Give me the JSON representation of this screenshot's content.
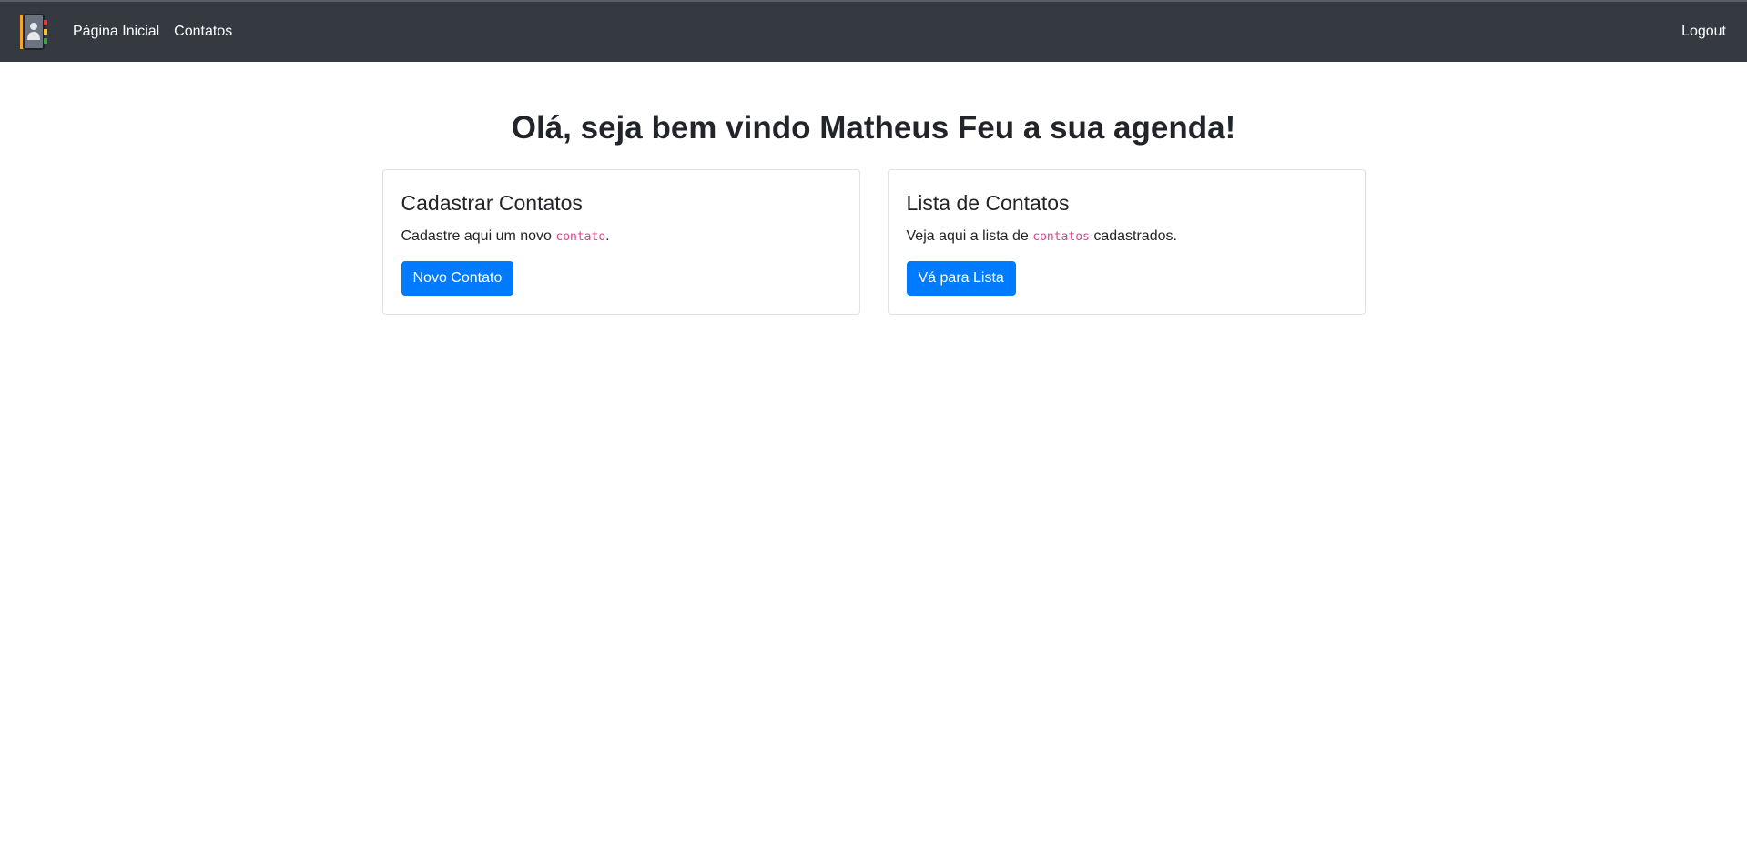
{
  "navbar": {
    "brand_icon": "address-book-icon",
    "links": [
      {
        "label": "Página Inicial"
      },
      {
        "label": "Contatos"
      }
    ],
    "logout_label": "Logout"
  },
  "main": {
    "heading": "Olá, seja bem vindo Matheus Feu a sua agenda!",
    "cards": [
      {
        "title": "Cadastrar Contatos",
        "text_before": "Cadastre aqui um novo ",
        "code": "contato",
        "text_after": ".",
        "button_label": "Novo Contato"
      },
      {
        "title": "Lista de Contatos",
        "text_before": "Veja aqui a lista de ",
        "code": "contatos",
        "text_after": " cadastrados.",
        "button_label": "Vá para Lista"
      }
    ]
  },
  "colors": {
    "navbar_bg": "#343a40",
    "primary": "#007bff",
    "code": "#e83e8c"
  }
}
